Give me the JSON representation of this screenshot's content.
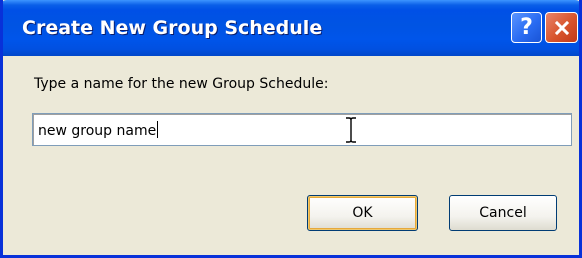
{
  "dialog": {
    "title": "Create New Group Schedule",
    "help_glyph": "?",
    "close_icon": "close-icon",
    "prompt": "Type a name for the new Group Schedule:",
    "input": {
      "value": "new group name",
      "has_focus": true
    },
    "ok_label": "OK",
    "cancel_label": "Cancel"
  },
  "colors": {
    "titlebar": "#0054e3",
    "close_button": "#d8542c",
    "face": "#ece9d8",
    "default_button_highlight": "#e6a93c"
  }
}
